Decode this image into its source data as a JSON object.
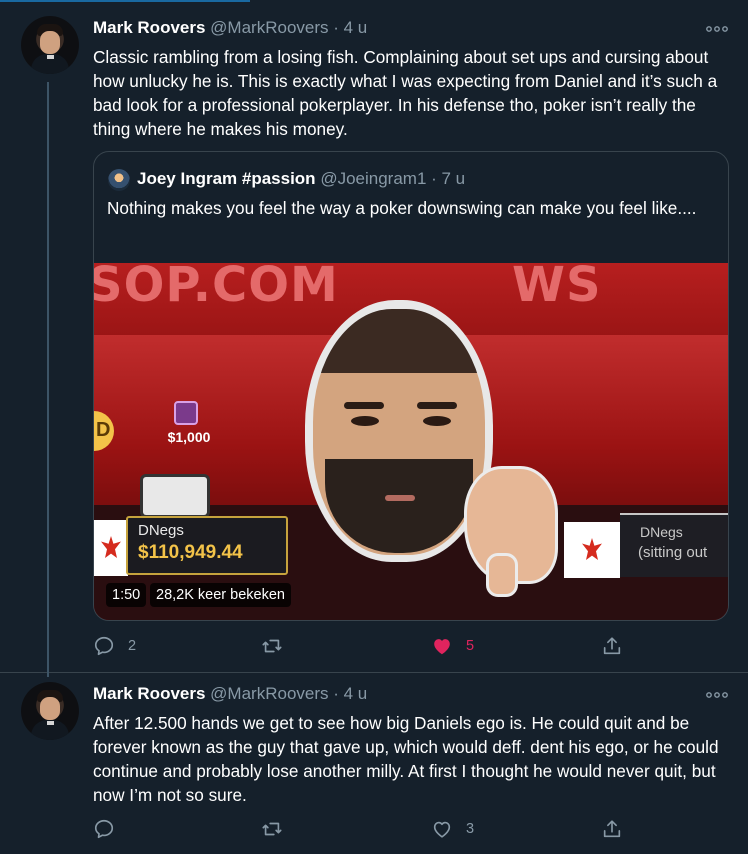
{
  "tweets": [
    {
      "author_name": "Mark Roovers",
      "author_meta": "@MarkRoovers · 4 u",
      "text": "Classic rambling from a losing fish. Complaining about set ups and cursing about how unlucky he is. This is exactly what I was expecting from Daniel and it’s such a bad look for a professional pokerplayer. In his defense tho, poker isn’t really the thing where he makes his money.",
      "quote": {
        "author_name": "Joey Ingram #passion",
        "author_meta": "@Joeingram1 · 7 u",
        "text": "Nothing makes you feel the way a poker downswing can make you feel like....",
        "video": {
          "duration": "1:50",
          "views": "28,2K keer bekeken",
          "scene": {
            "logo_left": "SOP.COM",
            "logo_right": "WS",
            "chip_value": "$1,000",
            "coin_label": "D",
            "plate_name": "DNegs",
            "plate_amount": "$110,949.44",
            "right_name": "DNegs",
            "right_status": "(sitting out"
          }
        }
      },
      "actions": {
        "reply": "2",
        "retweet": "",
        "like": "5",
        "liked": true
      }
    },
    {
      "author_name": "Mark Roovers",
      "author_meta": "@MarkRoovers · 4 u",
      "text": "After 12.500 hands we get to see how big Daniels ego is. He could quit and be forever known as the guy that gave up, which would deff. dent his ego, or he could continue and probably lose another milly. At first I thought he would never quit, but now I’m not so sure.",
      "actions": {
        "reply": "",
        "retweet": "",
        "like": "3",
        "liked": false
      }
    }
  ],
  "colors": {
    "background": "#15202b",
    "muted": "#8899a6",
    "like": "#e0245e",
    "border": "#38444d"
  },
  "icons": [
    "more-icon",
    "reply-icon",
    "retweet-icon",
    "heart-icon",
    "share-icon"
  ]
}
